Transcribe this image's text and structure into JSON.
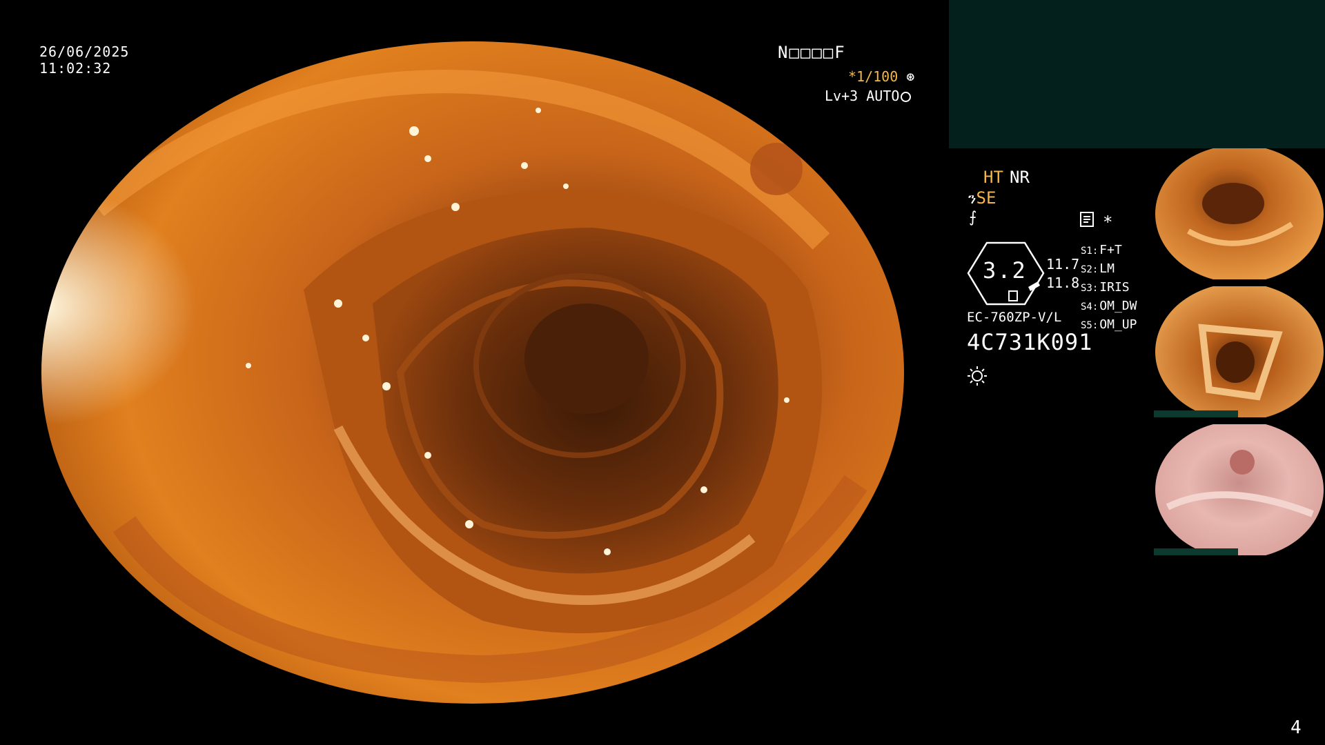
{
  "overlay": {
    "date": "26/06/2025",
    "time": "11:02:32",
    "mode_code": "N□□□□F",
    "shutter": "*1/100",
    "level": "Lv+3 AUTO"
  },
  "panel": {
    "ht": "HT",
    "nr": "NR",
    "se_prefix": "ን",
    "se": "SE",
    "f_symbol": "⨍",
    "gauge_value": "3.2",
    "value_a": "11.7",
    "value_b": "11.8",
    "star": "*",
    "settings": [
      {
        "key": "S1:",
        "value": "F+T"
      },
      {
        "key": "S2:",
        "value": "LM"
      },
      {
        "key": "S3:",
        "value": "IRIS"
      },
      {
        "key": "S4:",
        "value": "OM_DW"
      },
      {
        "key": "S5:",
        "value": "OM_UP"
      }
    ],
    "scope_model": "EC-760ZP-V/L",
    "scope_serial": "4C731K091"
  },
  "page_number": "4",
  "colors": {
    "accent": "#f4b64a",
    "panel_dark": "#03201c",
    "mucosa": "#d86f1c"
  },
  "icons": [
    "shutter-icon",
    "auto-iris-icon",
    "document-icon",
    "light-icon"
  ]
}
